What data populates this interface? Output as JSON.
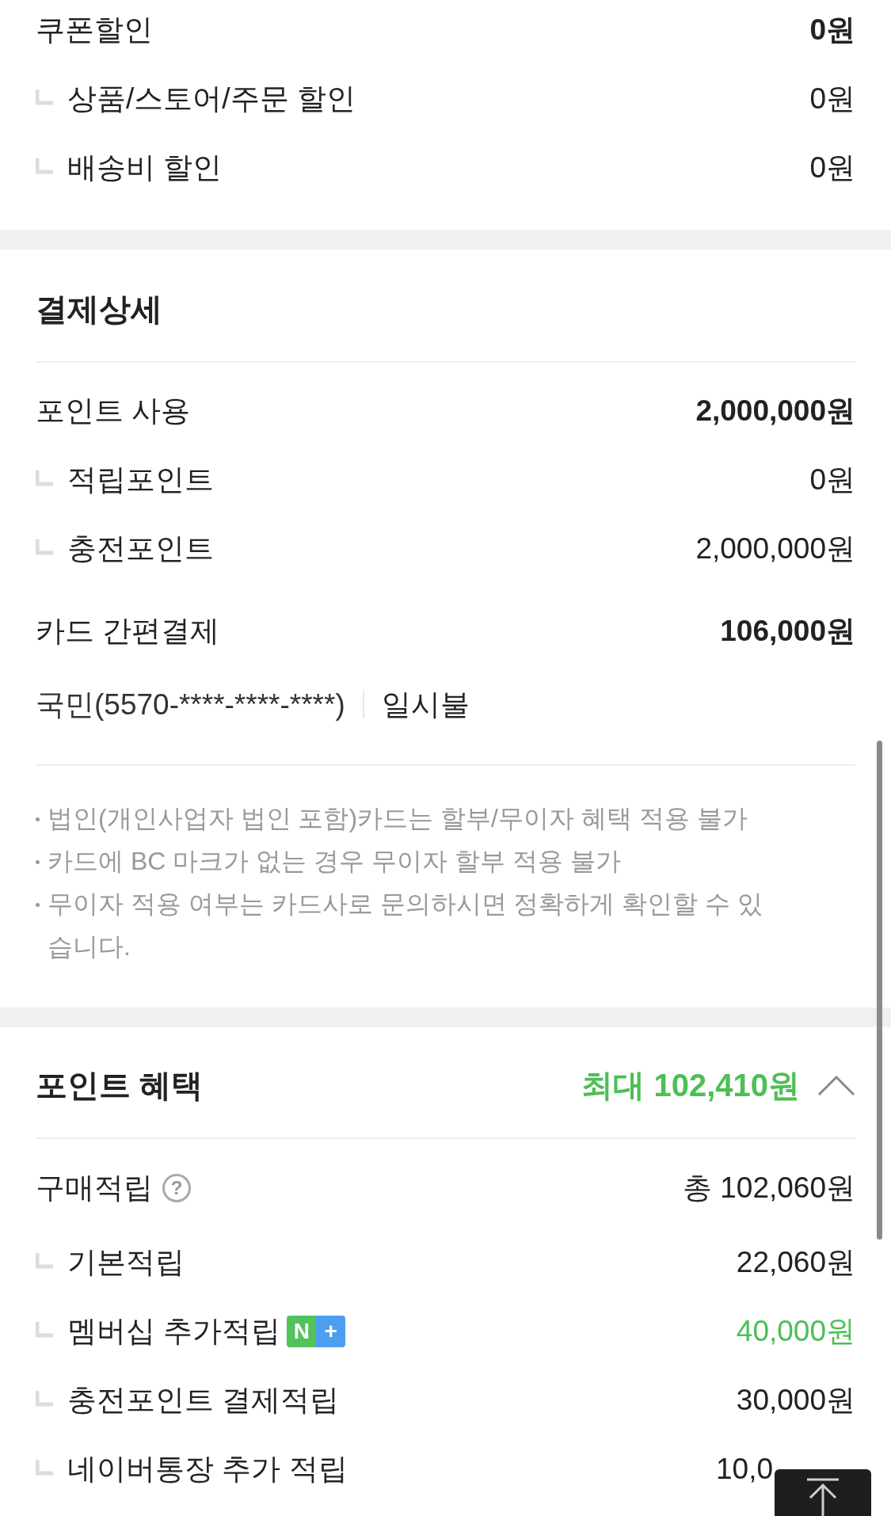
{
  "coupon_discount": {
    "label": "쿠폰할인",
    "amount": "0원",
    "items": [
      {
        "label": "상품/스토어/주문 할인",
        "amount": "0원"
      },
      {
        "label": "배송비 할인",
        "amount": "0원"
      }
    ]
  },
  "payment_details": {
    "title": "결제상세",
    "point_use": {
      "label": "포인트 사용",
      "amount": "2,000,000원",
      "items": [
        {
          "label": "적립포인트",
          "amount": "0원"
        },
        {
          "label": "충전포인트",
          "amount": "2,000,000원"
        }
      ]
    },
    "card_payment": {
      "label": "카드 간편결제",
      "amount": "106,000원",
      "card": "국민(5570-****-****-****)",
      "installment": "일시불"
    },
    "notes": [
      "법인(개인사업자 법인 포함)카드는 할부/무이자 혜택 적용 불가",
      "카드에 BC 마크가 없는 경우 무이자 할부 적용 불가",
      "무이자 적용 여부는 카드사로 문의하시면 정확하게 확인할 수 있습니다."
    ]
  },
  "point_benefits": {
    "title": "포인트 혜택",
    "max": "최대 102,410원",
    "expanded": true,
    "purchase": {
      "label": "구매적립",
      "help_icon": "?",
      "total": "총 102,060원",
      "items": [
        {
          "label": "기본적립",
          "amount": "22,060원",
          "highlight": false
        },
        {
          "label": "멤버십 추가적립",
          "amount": "40,000원",
          "highlight": true,
          "badge": [
            "N",
            "+"
          ]
        },
        {
          "label": "충전포인트 결제적립",
          "amount": "30,000원",
          "highlight": false
        },
        {
          "label": "네이버통장 추가 적립",
          "amount": "10,0",
          "highlight": false
        }
      ]
    }
  }
}
